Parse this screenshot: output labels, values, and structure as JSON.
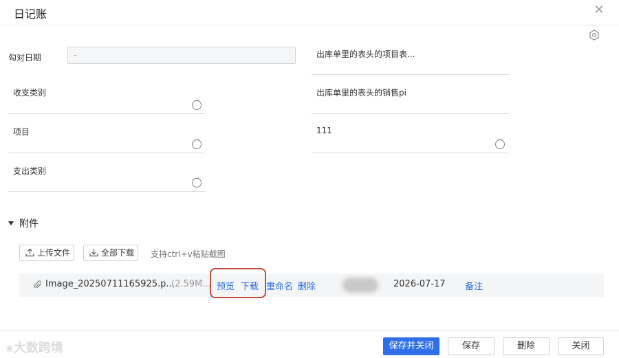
{
  "window": {
    "title": "日记账"
  },
  "form": {
    "check_date": {
      "label": "勾对日期",
      "value": "-"
    },
    "right_1": {
      "label": "出库单里的表头的项目表..."
    },
    "income_type": {
      "label": "收支类别"
    },
    "right_2": {
      "label": "出库单里的表头的销售pi"
    },
    "project": {
      "label": "项目"
    },
    "right_3": {
      "label": "111"
    },
    "expense_type": {
      "label": "支出类别"
    }
  },
  "attachments": {
    "section_label": "附件",
    "upload_label": "上传文件",
    "download_all_label": "全部下载",
    "hint": "支持ctrl+v粘贴截图",
    "files": [
      {
        "name": "Image_20250711165925.p...",
        "size": "(2.59M...",
        "preview": "预览",
        "download": "下载",
        "rename": "重命名",
        "delete": "删除",
        "date": "2026-07-17",
        "note": "备注"
      }
    ]
  },
  "footer": {
    "save_close": "保存并关闭",
    "save": "保存",
    "delete": "删除",
    "close": "关闭",
    "watermark": "大数跨境"
  },
  "colors": {
    "primary": "#2f6fe8",
    "link": "#2a6fe0",
    "highlight": "#c94a3b"
  }
}
